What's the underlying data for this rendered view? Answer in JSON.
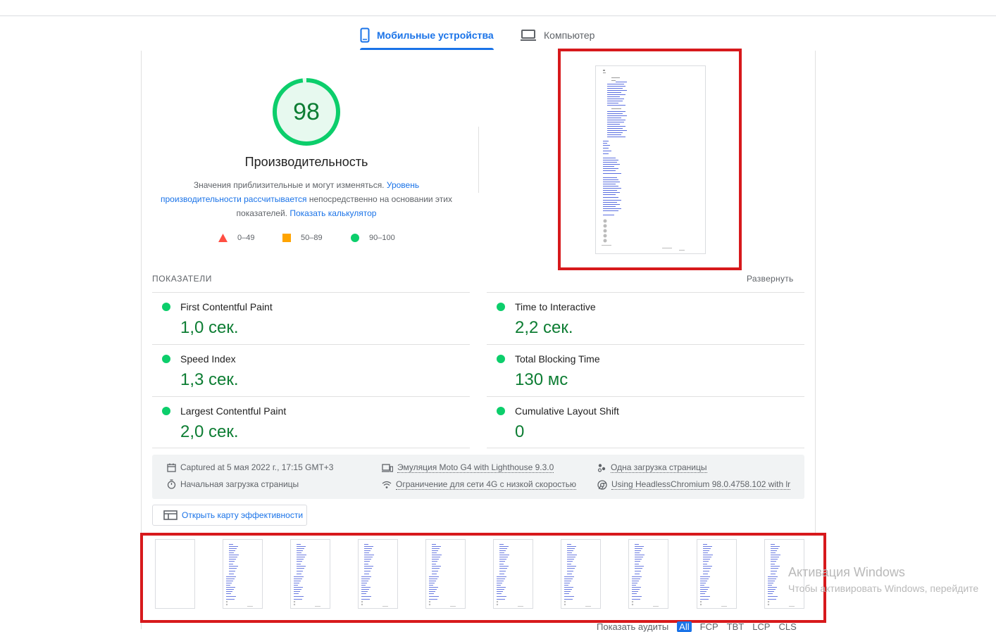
{
  "tabs": {
    "mobile": "Мобильные устройства",
    "desktop": "Компьютер"
  },
  "score": {
    "value": "98",
    "fraction": 0.98,
    "title": "Производительность",
    "desc_part1": "Значения приблизительные и могут изменяться.",
    "desc_link1": "Уровень производительности рассчитывается",
    "desc_part2": "непосредственно на основании этих показателей.",
    "desc_link2": "Показать калькулятор"
  },
  "legend": {
    "fail": "0–49",
    "average": "50–89",
    "pass": "90–100"
  },
  "metrics": {
    "header": "ПОКАЗАТЕЛИ",
    "expand": "Развернуть",
    "fcp": {
      "name": "First Contentful Paint",
      "value": "1,0 сек."
    },
    "tti": {
      "name": "Time to Interactive",
      "value": "2,2 сек."
    },
    "si": {
      "name": "Speed Index",
      "value": "1,3 сек."
    },
    "tbt": {
      "name": "Total Blocking Time",
      "value": "130 мс"
    },
    "lcp": {
      "name": "Largest Contentful Paint",
      "value": "2,0 сек."
    },
    "cls": {
      "name": "Cumulative Layout Shift",
      "value": "0"
    }
  },
  "info": {
    "captured": "Captured at 5 мая 2022 г., 17:15 GMT+3",
    "initial_load": "Начальная загрузка страницы",
    "emulation": "Эмуляция Moto G4 with Lighthouse 9.3.0",
    "throttling": "Ограничение для сети 4G с низкой скоростью",
    "single_load": "Одна загрузка страницы",
    "browser": "Using HeadlessChromium 98.0.4758.102 with lr"
  },
  "treemap_button": "Открыть карту эффективности",
  "watermark": {
    "line1": "Активация Windows",
    "line2": "Чтобы активировать Windows, перейдите"
  },
  "audits": {
    "label": "Показать аудиты",
    "chips": [
      "All",
      "FCP",
      "TBT",
      "LCP",
      "CLS"
    ]
  },
  "colors": {
    "accent": "#1a73e8",
    "pass": "#0cce6b",
    "pass_text": "#0d7d33",
    "fail": "#ff4e42",
    "average": "#ffa400",
    "highlight": "#d7191c"
  }
}
